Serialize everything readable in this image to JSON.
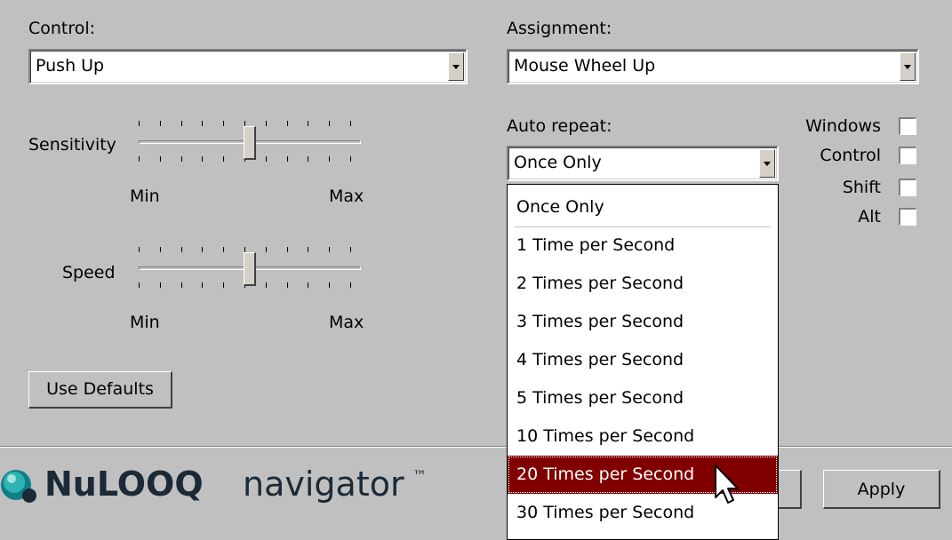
{
  "control": {
    "label": "Control:",
    "value": "Push Up"
  },
  "assignment": {
    "label": "Assignment:",
    "value": "Mouse Wheel Up"
  },
  "sensitivity": {
    "label": "Sensitivity",
    "min_label": "Min",
    "max_label": "Max",
    "value_fraction": 0.5
  },
  "speed": {
    "label": "Speed",
    "min_label": "Min",
    "max_label": "Max",
    "value_fraction": 0.5
  },
  "use_defaults_label": "Use Defaults",
  "auto_repeat": {
    "label": "Auto repeat:",
    "value": "Once Only",
    "options": [
      "Once Only",
      "1 Time per Second",
      "2 Times per Second",
      "3 Times per Second",
      "4 Times per Second",
      "5 Times per Second",
      "10 Times per Second",
      "20 Times per Second",
      "30 Times per Second"
    ],
    "highlighted_option": "20 Times per Second"
  },
  "modifiers": {
    "windows": {
      "label": "Windows",
      "checked": false
    },
    "control": {
      "label": "Control",
      "checked": false
    },
    "shift": {
      "label": "Shift",
      "checked": false
    },
    "alt": {
      "label": "Alt",
      "checked": false
    }
  },
  "logo": {
    "brand": "NuLOOQ",
    "product": "navigator",
    "mark": "™"
  },
  "apply_label": "Apply",
  "colors": {
    "background": "#c0c0c0",
    "highlight": "#800000",
    "logo_teal": "#1a9a9a"
  }
}
